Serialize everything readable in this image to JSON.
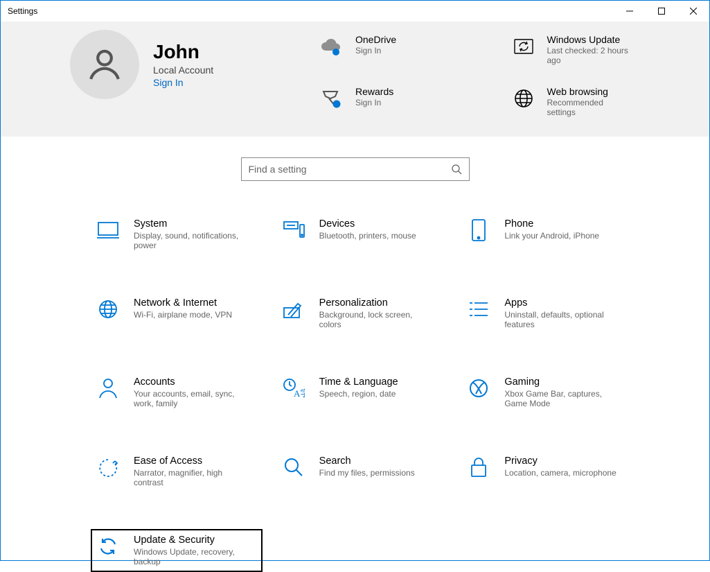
{
  "window": {
    "title": "Settings"
  },
  "user": {
    "name": "John",
    "type": "Local Account",
    "signin": "Sign In"
  },
  "tiles": [
    {
      "title": "OneDrive",
      "sub": "Sign In"
    },
    {
      "title": "Windows Update",
      "sub": "Last checked: 2 hours ago"
    },
    {
      "title": "Rewards",
      "sub": "Sign In"
    },
    {
      "title": "Web browsing",
      "sub": "Recommended settings"
    }
  ],
  "search": {
    "placeholder": "Find a setting"
  },
  "cats": [
    {
      "title": "System",
      "sub": "Display, sound, notifications, power"
    },
    {
      "title": "Devices",
      "sub": "Bluetooth, printers, mouse"
    },
    {
      "title": "Phone",
      "sub": "Link your Android, iPhone"
    },
    {
      "title": "Network & Internet",
      "sub": "Wi-Fi, airplane mode, VPN"
    },
    {
      "title": "Personalization",
      "sub": "Background, lock screen, colors"
    },
    {
      "title": "Apps",
      "sub": "Uninstall, defaults, optional features"
    },
    {
      "title": "Accounts",
      "sub": "Your accounts, email, sync, work, family"
    },
    {
      "title": "Time & Language",
      "sub": "Speech, region, date"
    },
    {
      "title": "Gaming",
      "sub": "Xbox Game Bar, captures, Game Mode"
    },
    {
      "title": "Ease of Access",
      "sub": "Narrator, magnifier, high contrast"
    },
    {
      "title": "Search",
      "sub": "Find my files, permissions"
    },
    {
      "title": "Privacy",
      "sub": "Location, camera, microphone"
    },
    {
      "title": "Update & Security",
      "sub": "Windows Update, recovery, backup"
    }
  ]
}
